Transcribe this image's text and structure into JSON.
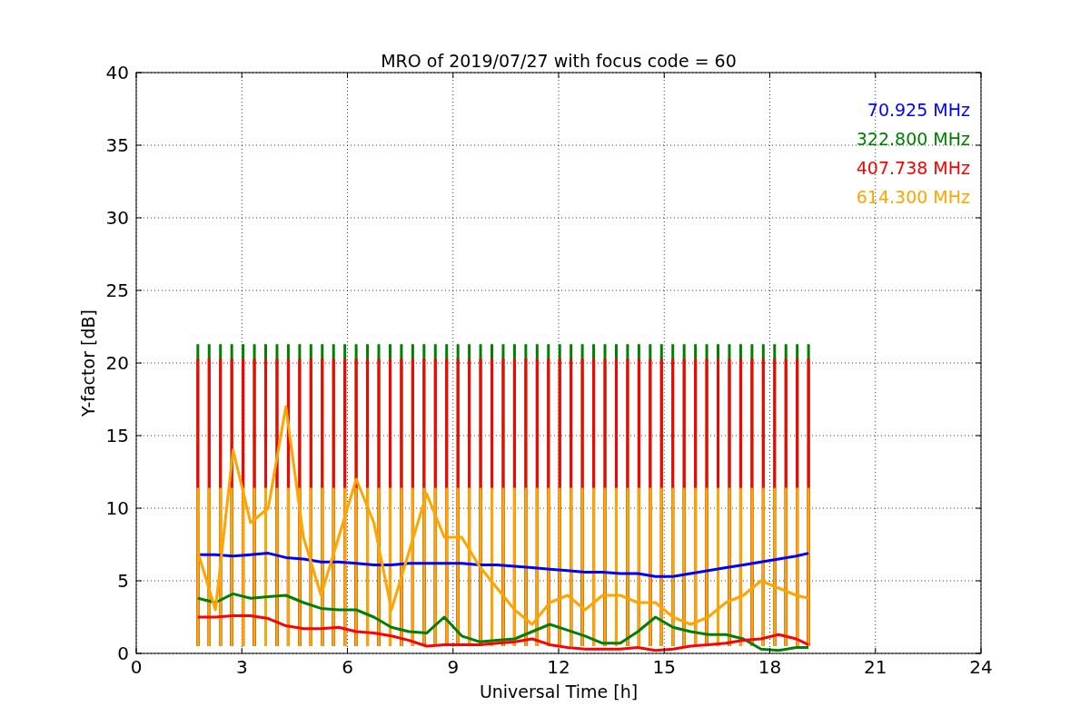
{
  "chart_data": {
    "type": "line",
    "title": "MRO of 2019/07/27 with focus code = 60",
    "xlabel": "Universal Time [h]",
    "ylabel": "Y-factor [dB]",
    "xlim": [
      0,
      24
    ],
    "ylim": [
      0,
      40
    ],
    "xticks": [
      0,
      3,
      6,
      9,
      12,
      15,
      18,
      21,
      24
    ],
    "yticks": [
      0,
      5,
      10,
      15,
      20,
      25,
      30,
      35,
      40
    ],
    "x": [
      1.75,
      2.25,
      2.75,
      3.25,
      3.75,
      4.25,
      4.75,
      5.25,
      5.75,
      6.25,
      6.75,
      7.25,
      7.75,
      8.25,
      8.75,
      9.25,
      9.75,
      10.25,
      10.75,
      11.25,
      11.75,
      12.25,
      12.75,
      13.25,
      13.75,
      14.25,
      14.75,
      15.25,
      15.75,
      16.25,
      16.75,
      17.25,
      17.75,
      18.25,
      18.75,
      19.1
    ],
    "grid": true,
    "series": [
      {
        "name": "70.925 MHz",
        "color": "#0000ff",
        "values": [
          6.8,
          6.8,
          6.7,
          6.8,
          6.9,
          6.6,
          6.5,
          6.3,
          6.3,
          6.2,
          6.1,
          6.1,
          6.2,
          6.2,
          6.2,
          6.2,
          6.1,
          6.1,
          6.0,
          5.9,
          5.8,
          5.7,
          5.6,
          5.6,
          5.5,
          5.5,
          5.3,
          5.3,
          5.5,
          5.7,
          5.9,
          6.1,
          6.3,
          6.5,
          6.7,
          6.9
        ]
      },
      {
        "name": "322.800 MHz",
        "color": "#008000",
        "values": [
          3.8,
          3.5,
          4.1,
          3.8,
          3.9,
          4.0,
          3.5,
          3.1,
          3.0,
          3.0,
          2.5,
          1.8,
          1.5,
          1.4,
          2.5,
          1.2,
          0.8,
          0.9,
          1.0,
          1.5,
          2.0,
          1.6,
          1.2,
          0.7,
          0.7,
          1.5,
          2.5,
          1.8,
          1.5,
          1.3,
          1.3,
          1.0,
          0.3,
          0.2,
          0.4,
          0.4
        ]
      },
      {
        "name": "407.738 MHz",
        "color": "#ff0000",
        "values": [
          2.5,
          2.5,
          2.6,
          2.6,
          2.4,
          1.9,
          1.7,
          1.7,
          1.8,
          1.5,
          1.4,
          1.2,
          0.9,
          0.5,
          0.6,
          0.6,
          0.6,
          0.7,
          0.8,
          1.0,
          0.6,
          0.4,
          0.3,
          0.3,
          0.3,
          0.4,
          0.2,
          0.3,
          0.5,
          0.6,
          0.7,
          0.9,
          1.0,
          1.3,
          1.0,
          0.6
        ]
      },
      {
        "name": "614.300 MHz",
        "color": "#ffa500",
        "values": [
          7.0,
          3.0,
          14.0,
          9.0,
          10.0,
          17.0,
          8.0,
          4.0,
          8.0,
          12.0,
          9.0,
          3.0,
          7.0,
          11.0,
          8.0,
          8.0,
          6.0,
          4.5,
          3.0,
          2.0,
          3.5,
          4.0,
          3.0,
          4.0,
          4.0,
          3.5,
          3.5,
          2.5,
          2.0,
          2.5,
          3.5,
          4.0,
          5.0,
          4.5,
          4.0,
          3.8
        ]
      }
    ]
  }
}
